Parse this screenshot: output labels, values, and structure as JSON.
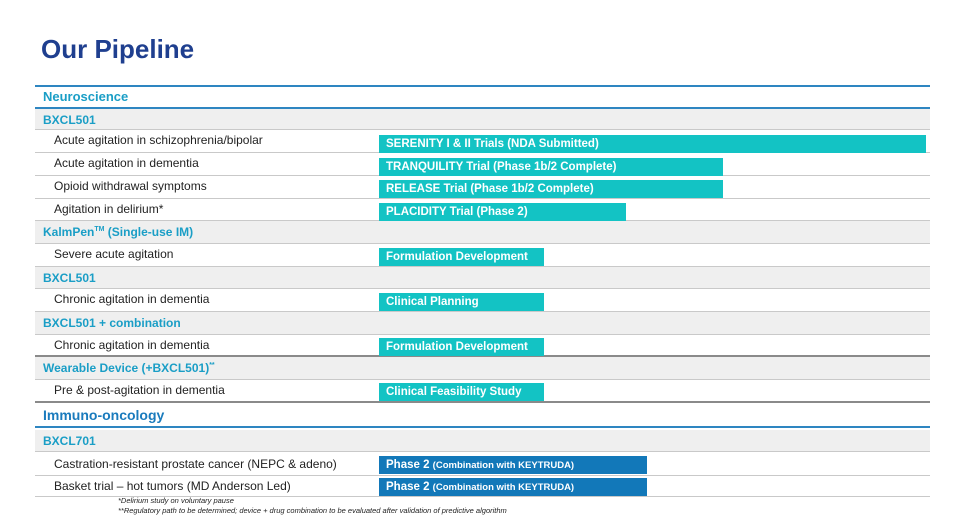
{
  "title": "Our Pipeline",
  "neuro": {
    "section": "Neuroscience",
    "bxcl501_a": "BXCL501",
    "row1": "Acute agitation in schizophrenia/bipolar",
    "row2": "Acute agitation in dementia",
    "row3": "Opioid withdrawal symptoms",
    "row4": "Agitation in delirium*",
    "kalmpen": "KalmPen",
    "kalmpen_sup": "TM",
    "kalmpen_rest": " (Single-use IM)",
    "row5": "Severe acute agitation",
    "bxcl501_b": "BXCL501",
    "row6": "Chronic agitation in dementia",
    "combo": "BXCL501 + combination",
    "row7": "Chronic agitation in dementia",
    "wearable": "Wearable Device (+BXCL501)",
    "wearable_sup": "**",
    "row8": "Pre & post-agitation in dementia"
  },
  "onc": {
    "section": "Immuno-oncology",
    "bxcl701": "BXCL701",
    "row1": "Castration-resistant prostate cancer (NEPC & adeno)",
    "row2": "Basket trial – hot tumors (MD Anderson Led)"
  },
  "bars": {
    "b1": "SERENITY I & II Trials (NDA Submitted)",
    "b2": "TRANQUILITY Trial (Phase 1b/2 Complete)",
    "b3": "RELEASE Trial (Phase 1b/2 Complete)",
    "b4": "PLACIDITY Trial (Phase 2)",
    "b5": "Formulation Development",
    "b6": "Clinical Planning",
    "b7": "Formulation Development",
    "b8": "Clinical Feasibility Study",
    "b9_main": "Phase 2 ",
    "b9_small": "(Combination with KEYTRUDA)",
    "b10_main": "Phase 2 ",
    "b10_small": "(Combination with KEYTRUDA)"
  },
  "footnotes": {
    "f1": "*Delirium study on voluntary pause",
    "f2": "**Regulatory path to be determined; device + drug combination to be evaluated after validation of predictive algorithm"
  },
  "colors": {
    "title": "#1f3f8f",
    "section_text": "#1a9ec6",
    "rule": "#2e86c1",
    "bar_teal": "#13c3c4",
    "bar_blue": "#1278b9"
  }
}
